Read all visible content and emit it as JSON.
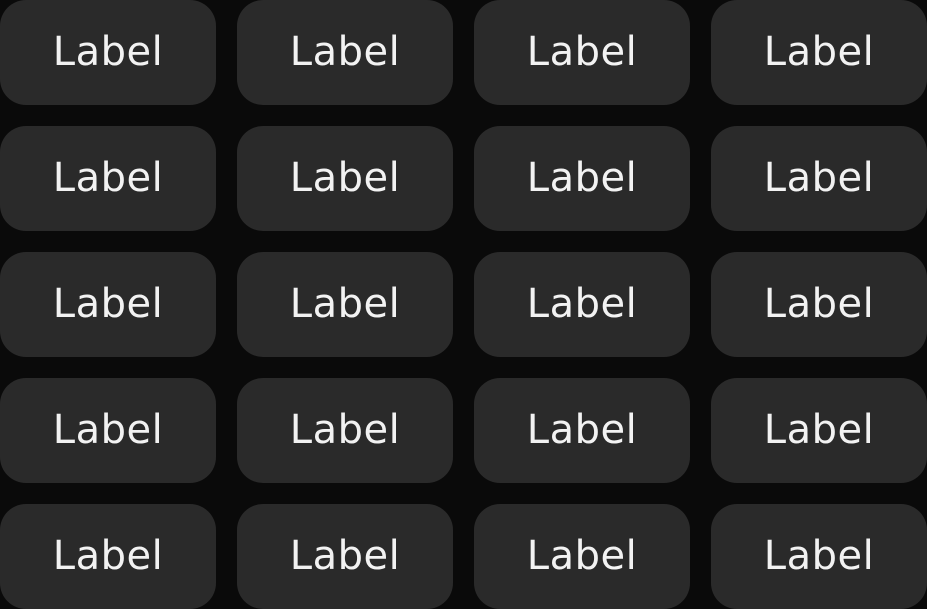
{
  "grid": {
    "rows": [
      [
        "Label",
        "Label",
        "Label",
        "Label"
      ],
      [
        "Label",
        "Label",
        "Label",
        "Label"
      ],
      [
        "Label",
        "Label",
        "Label",
        "Label"
      ],
      [
        "Label",
        "Label",
        "Label",
        "Label"
      ],
      [
        "Label",
        "Label",
        "Label",
        "Label"
      ]
    ]
  },
  "colors": {
    "background": "#0a0a0a",
    "button_background": "#2a2a2a",
    "button_text": "#f2f2f2"
  }
}
